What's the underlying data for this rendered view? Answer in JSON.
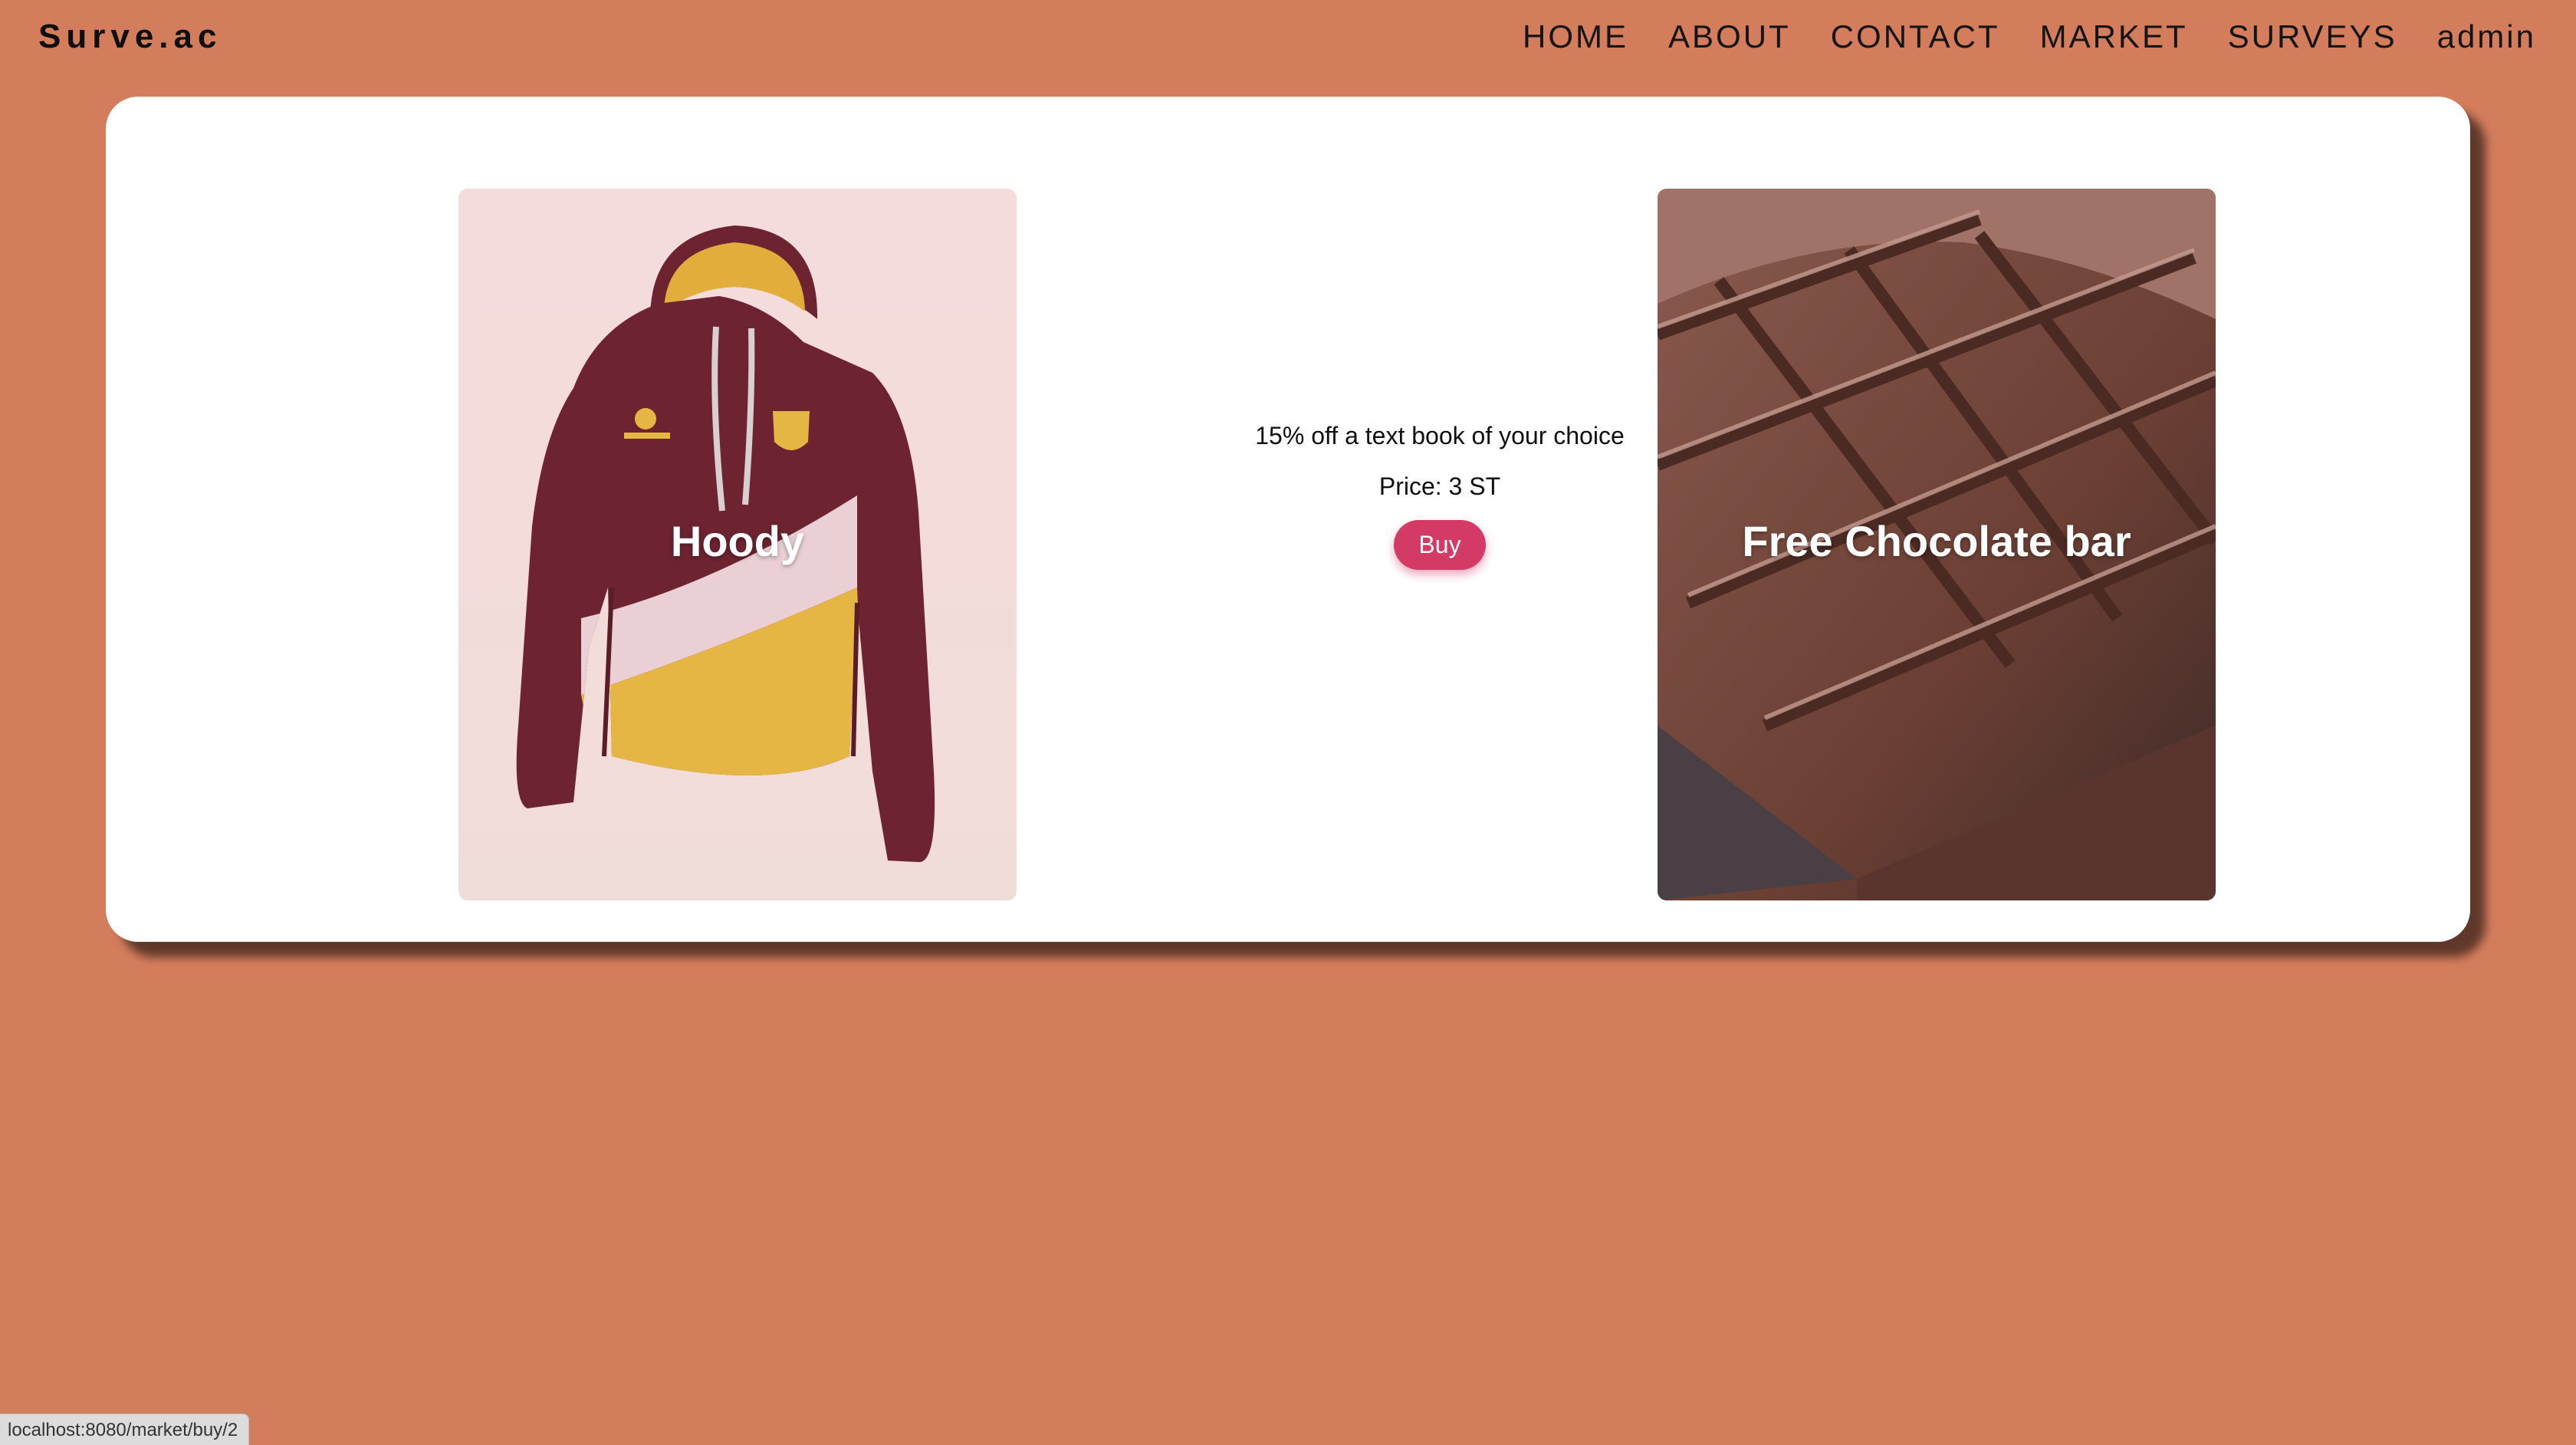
{
  "brand": "Surve.ac",
  "nav": {
    "items": [
      {
        "label": "HOME"
      },
      {
        "label": "ABOUT"
      },
      {
        "label": "CONTACT"
      },
      {
        "label": "MARKET"
      },
      {
        "label": "SURVEYS"
      },
      {
        "label": "admin"
      }
    ]
  },
  "market": {
    "cards": [
      {
        "title": "Hoody",
        "image": "hoodie-photo"
      },
      {
        "title": "Free Chocolate bar",
        "image": "chocolate-bar-photo"
      }
    ],
    "selected": {
      "description": "15% off a text book of your choice",
      "price": "Price: 3 ST",
      "buy_label": "Buy"
    }
  },
  "status_bar": {
    "url": "localhost:8080/market/buy/2"
  },
  "colors": {
    "background": "#d47d5d",
    "panel": "#ffffff",
    "buy_button": "#d43a66",
    "hoodie_body": "#6e2430",
    "hoodie_accent": "#e6b645",
    "chocolate": "#6b3f34"
  }
}
